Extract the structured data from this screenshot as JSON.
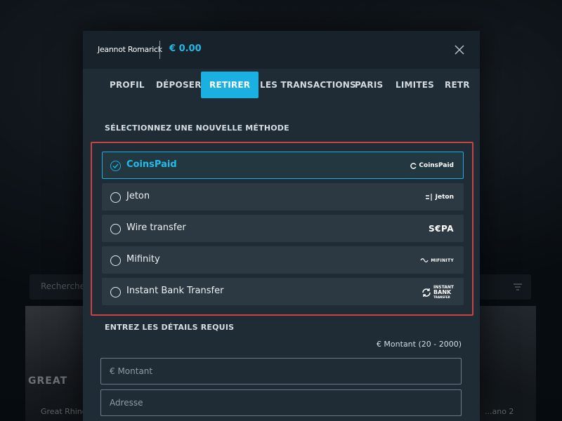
{
  "background": {
    "search_placeholder": "Recherche",
    "card_left_title": "GREAT",
    "card_left_name": "Great Rhino",
    "card_right_name": "...ano 2"
  },
  "header": {
    "user_name": "Jeannot Romarick",
    "balance": "€ 0.00"
  },
  "tabs": [
    {
      "label": "PROFIL"
    },
    {
      "label": "DÉPOSER"
    },
    {
      "label": "RETIRER",
      "active": true
    },
    {
      "label": "LES TRANSACTIONS"
    },
    {
      "label": "PARIS"
    },
    {
      "label": "LIMITES"
    },
    {
      "label": "RETR"
    }
  ],
  "methods_section": {
    "title": "SÉLECTIONNEZ UNE NOUVELLE MÉTHODE",
    "methods": [
      {
        "label": "CoinsPaid",
        "logo": "CoinsPaid",
        "selected": true
      },
      {
        "label": "Jeton",
        "logo": "Jeton",
        "selected": false
      },
      {
        "label": "Wire transfer",
        "logo": "S€PA",
        "selected": false
      },
      {
        "label": "Mifinity",
        "logo": "MIFINITY",
        "selected": false
      },
      {
        "label": "Instant Bank Transfer",
        "logo_lines": [
          "INSTANT",
          "BANK",
          "TRANSFER"
        ],
        "selected": false
      }
    ]
  },
  "details_section": {
    "title": "ENTREZ LES DÉTAILS REQUIS",
    "amount_range": "€ Montant (20 - 2000)",
    "amount_placeholder": "€ Montant",
    "address_placeholder": "Adresse"
  },
  "colors": {
    "accent": "#1ab0e2",
    "highlight_border": "#c94343",
    "modal_bg": "#1f2b35",
    "method_bg": "#2c3942"
  }
}
